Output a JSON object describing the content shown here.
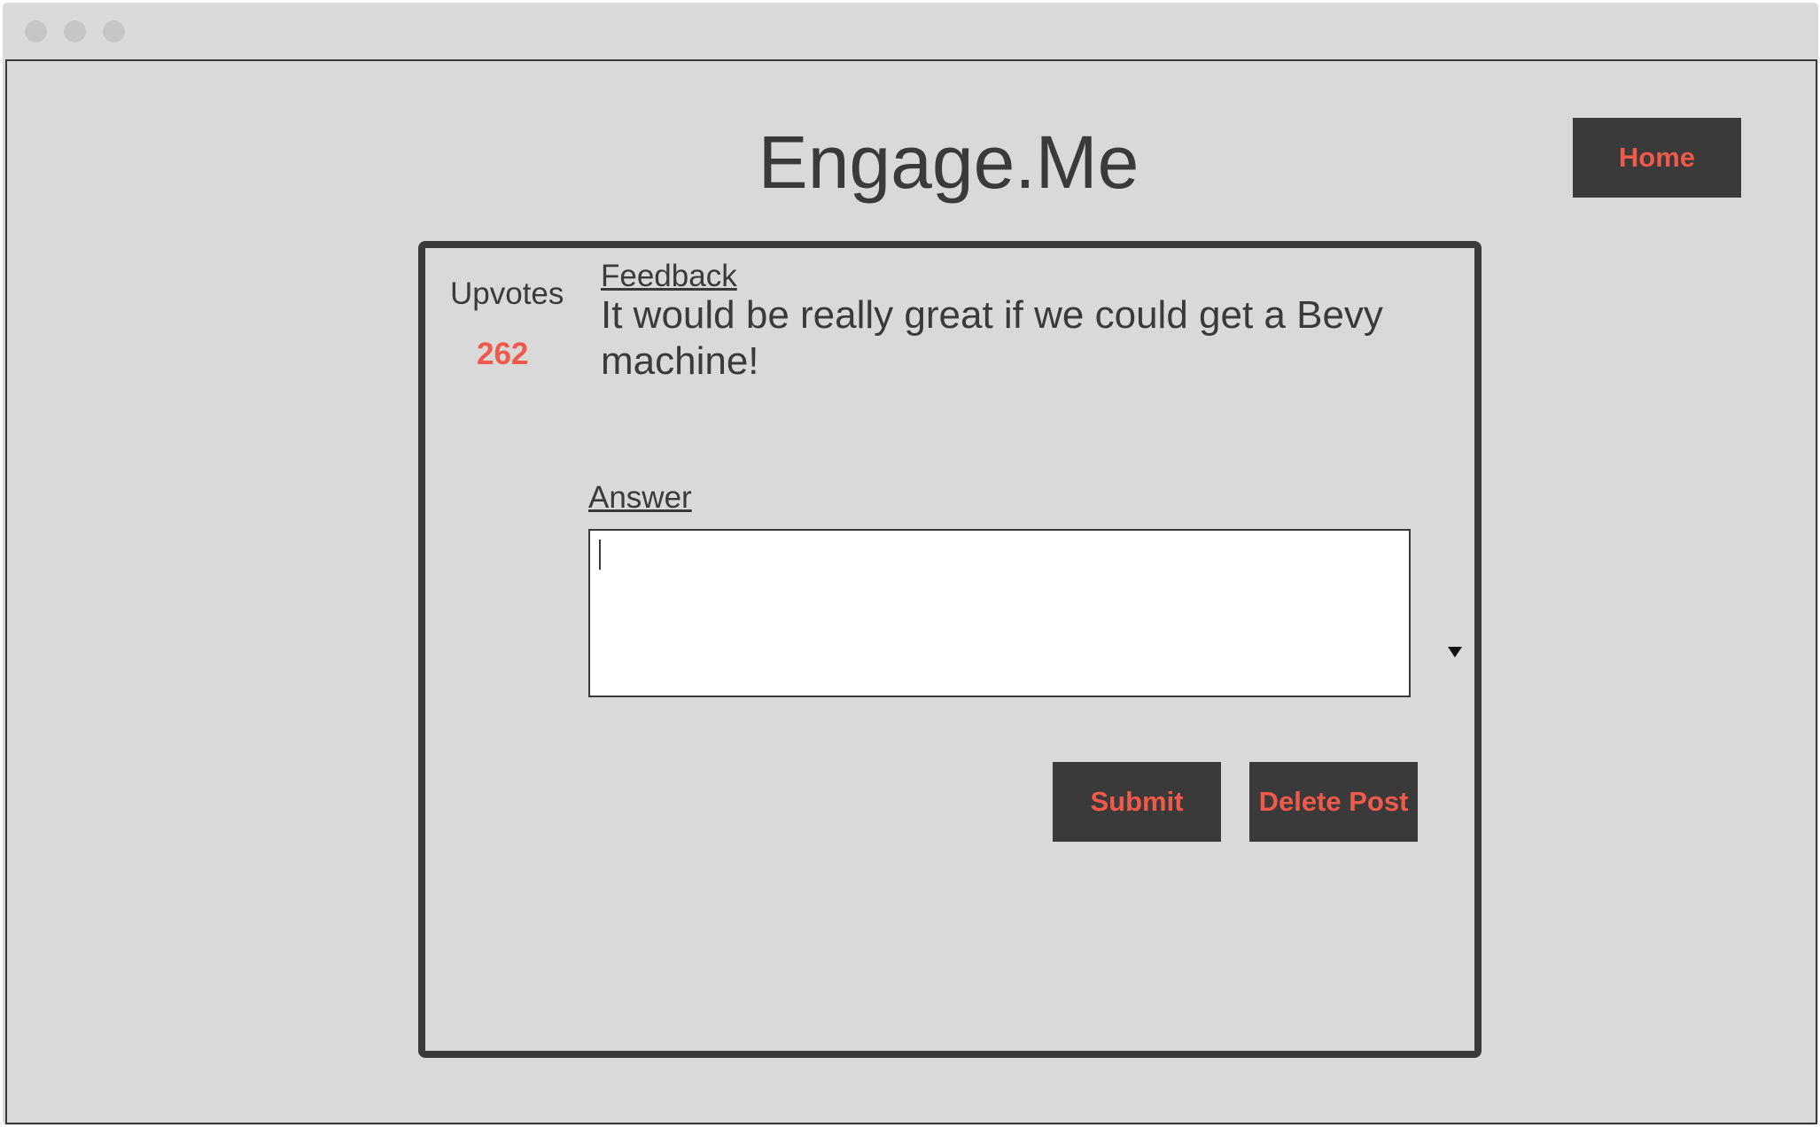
{
  "app": {
    "title": "Engage.Me"
  },
  "nav": {
    "home_label": "Home"
  },
  "post": {
    "upvotes_label": "Upvotes",
    "upvotes_count": "262",
    "feedback_label": "Feedback",
    "feedback_text": "It would be really great if we could get a Bevy machine!"
  },
  "answer": {
    "label": "Answer",
    "value": "",
    "placeholder": ""
  },
  "actions": {
    "submit_label": "Submit",
    "delete_label": "Delete Post"
  },
  "colors": {
    "background": "#d9d9d9",
    "dark": "#3a3a3a",
    "accent": "#f05a4a",
    "input_bg": "#ffffff"
  },
  "icons": {
    "dropdown": "chevron-down-icon"
  }
}
